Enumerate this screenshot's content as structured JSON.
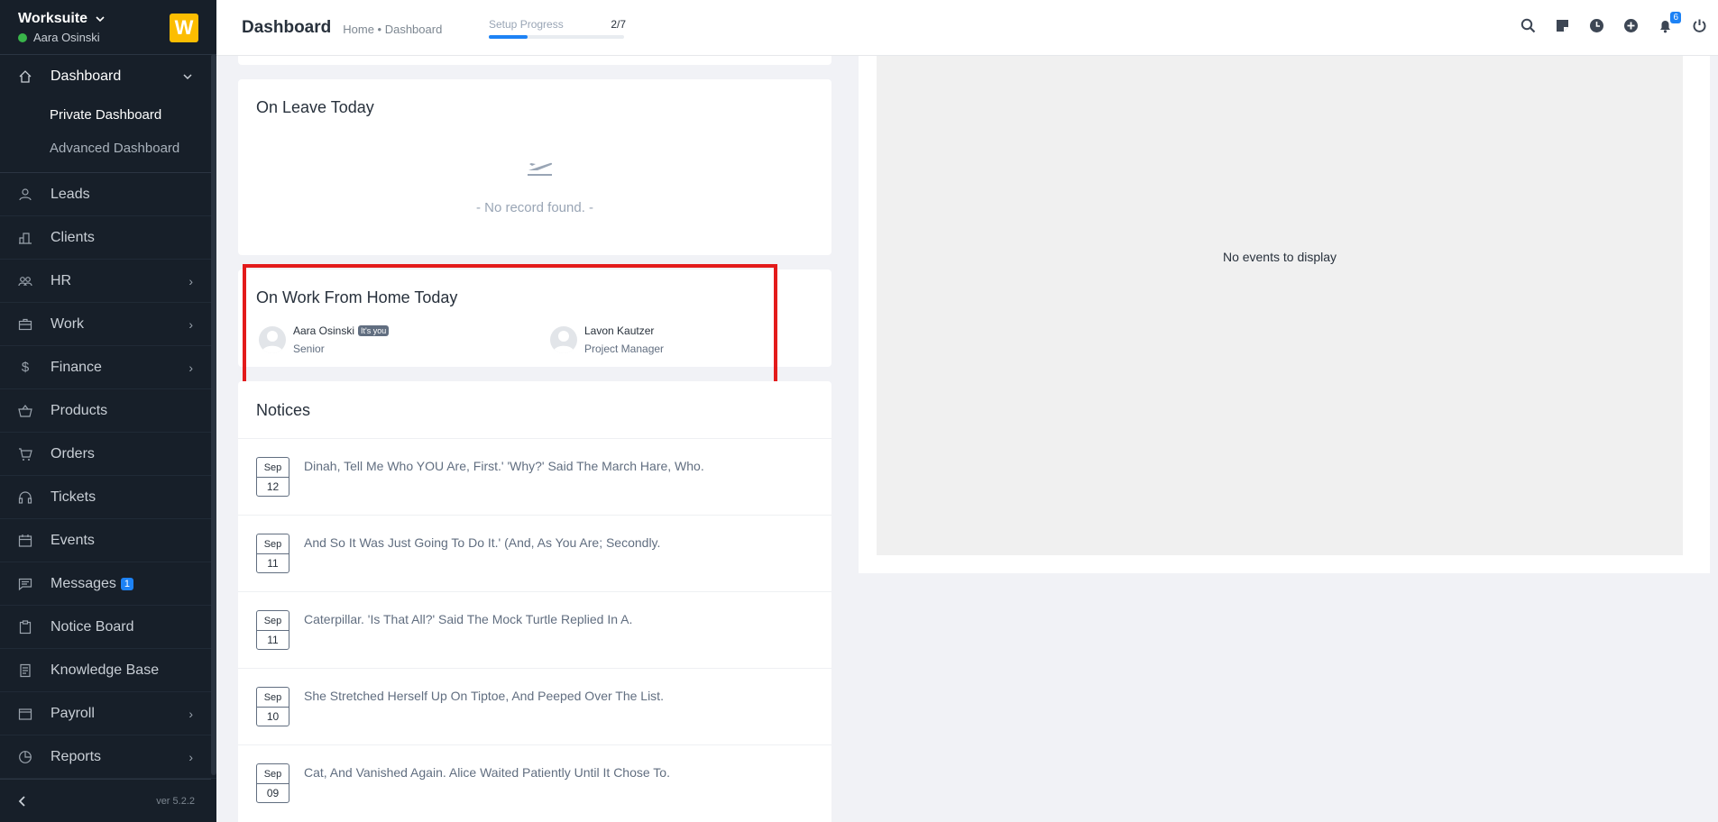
{
  "sidebar": {
    "company": "Worksuite",
    "user": "Aara Osinski",
    "logo_letter": "W",
    "dashboard": {
      "label": "Dashboard",
      "sub": [
        "Private Dashboard",
        "Advanced Dashboard"
      ]
    },
    "items": [
      {
        "label": "Leads",
        "icon": "user-icon"
      },
      {
        "label": "Clients",
        "icon": "building-icon"
      },
      {
        "label": "HR",
        "icon": "people-icon"
      },
      {
        "label": "Work",
        "icon": "briefcase-icon"
      },
      {
        "label": "Finance",
        "icon": "dollar-icon"
      },
      {
        "label": "Products",
        "icon": "basket-icon"
      },
      {
        "label": "Orders",
        "icon": "cart-icon"
      },
      {
        "label": "Tickets",
        "icon": "headset-icon"
      },
      {
        "label": "Events",
        "icon": "calendar-icon"
      },
      {
        "label": "Messages",
        "icon": "chat-icon",
        "badge": "1"
      },
      {
        "label": "Notice Board",
        "icon": "clipboard-icon"
      },
      {
        "label": "Knowledge Base",
        "icon": "book-icon"
      },
      {
        "label": "Payroll",
        "icon": "wallet-icon"
      },
      {
        "label": "Reports",
        "icon": "pie-icon"
      }
    ],
    "version": "ver 5.2.2"
  },
  "header": {
    "title": "Dashboard",
    "breadcrumb": "Home • Dashboard",
    "setup_label": "Setup Progress",
    "setup_fraction": "2/7",
    "setup_progress": 0.2857,
    "notification_count": "6"
  },
  "on_leave": {
    "title": "On Leave Today",
    "empty": "- No record found. -"
  },
  "wfh": {
    "title": "On Work From Home Today",
    "people": [
      {
        "name": "Aara Osinski",
        "tag": "It's you",
        "role": "Senior"
      },
      {
        "name": "Lavon Kautzer",
        "role": "Project Manager"
      }
    ]
  },
  "notices": {
    "title": "Notices",
    "items": [
      {
        "month": "Sep",
        "day": "12",
        "text": "Dinah, Tell Me Who YOU Are, First.' 'Why?' Said The March Hare, Who."
      },
      {
        "month": "Sep",
        "day": "11",
        "text": "And So It Was Just Going To Do It.' (And, As You Are; Secondly."
      },
      {
        "month": "Sep",
        "day": "11",
        "text": "Caterpillar. 'Is That All?' Said The Mock Turtle Replied In A."
      },
      {
        "month": "Sep",
        "day": "10",
        "text": "She Stretched Herself Up On Tiptoe, And Peeped Over The List."
      },
      {
        "month": "Sep",
        "day": "09",
        "text": "Cat, And Vanished Again. Alice Waited Patiently Until It Chose To."
      }
    ]
  },
  "calendar": {
    "empty": "No events to display"
  }
}
